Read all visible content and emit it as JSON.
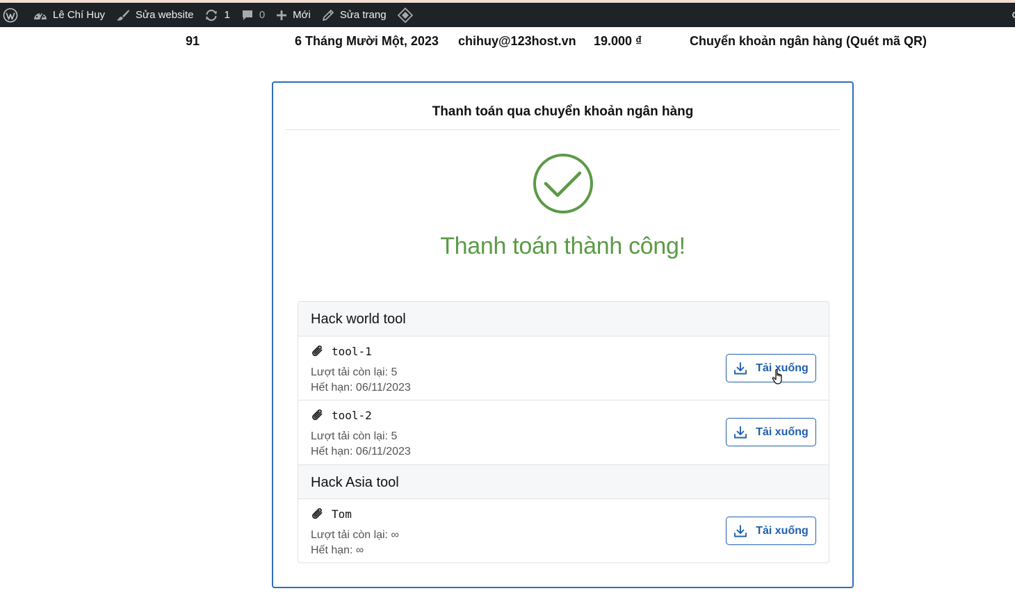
{
  "adminbar": {
    "site_name": "Lê Chí Huy",
    "customize": "Sửa website",
    "updates_count": "1",
    "comments_count": "0",
    "new": "Mới",
    "edit_page": "Sửa trang"
  },
  "order": {
    "number": "91",
    "date": "6 Tháng Mười Một, 2023",
    "email": "chihuy@123host.vn",
    "total": "19.000 ₫",
    "method": "Chuyển khoản ngân hàng (Quét mã QR)"
  },
  "payment": {
    "title": "Thanh toán qua chuyển khoản ngân hàng",
    "success_message": "Thanh toán thành công!"
  },
  "downloads": {
    "groups": [
      {
        "product": "Hack world tool",
        "files": [
          {
            "name": "tool-1",
            "remaining": "Lượt tải còn lại: 5",
            "expiry": "Hết hạn: 06/11/2023",
            "button": "Tải xuống"
          },
          {
            "name": "tool-2",
            "remaining": "Lượt tải còn lại: 5",
            "expiry": "Hết hạn: 06/11/2023",
            "button": "Tải xuống"
          }
        ]
      },
      {
        "product": "Hack Asia tool",
        "files": [
          {
            "name": "Tom",
            "remaining": "Lượt tải còn lại: ∞",
            "expiry": "Hết hạn: ∞",
            "button": "Tải xuống"
          }
        ]
      }
    ]
  },
  "icons": {
    "wordpress": "wordpress-logo-icon",
    "dashboard": "dashboard-icon",
    "customize": "brush-icon",
    "updates": "refresh-icon",
    "comments": "comment-icon",
    "new": "plus-icon",
    "edit": "pencil-icon",
    "diamond": "diamond-icon",
    "success": "check-circle-icon",
    "attachment": "paperclip-icon",
    "download": "download-icon",
    "cursor": "hand-pointer-icon"
  },
  "colors": {
    "adminbar_bg": "#1d2327",
    "card_border": "#2f6eb5",
    "success_green": "#5b9a46",
    "button_blue": "#1f5fae"
  }
}
